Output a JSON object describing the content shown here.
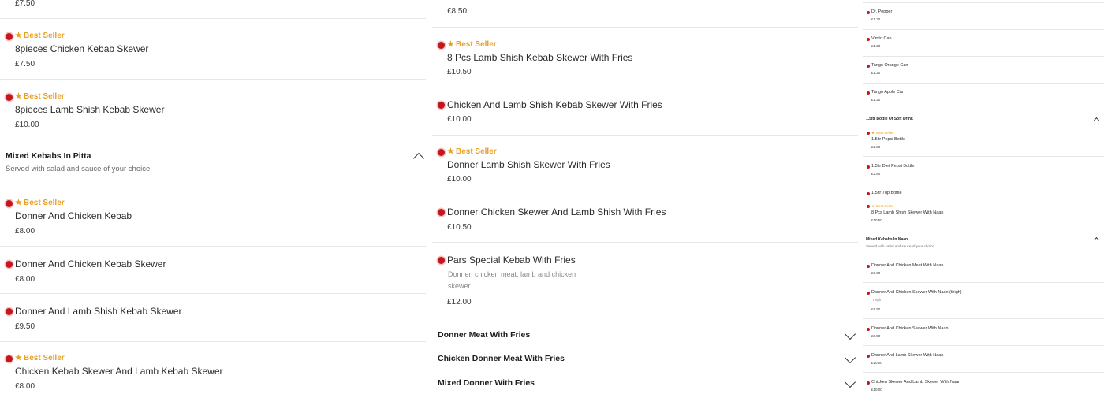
{
  "badge_label": "Best Seller",
  "colors": {
    "accent": "#c4161c",
    "badge": "#e8a024"
  },
  "col1": {
    "top_price": "£7.50",
    "items_a": [
      {
        "name": "8pieces Chicken Kebab Skewer",
        "price": "£7.50",
        "best_seller": true
      },
      {
        "name": "8pieces Lamb Shish Kebab Skewer",
        "price": "£10.00",
        "best_seller": true
      }
    ],
    "section": {
      "title": "Mixed Kebabs In Pitta",
      "subtitle": "Served with salad and sauce of your choice"
    },
    "items_b": [
      {
        "name": "Donner And Chicken Kebab",
        "price": "£8.00",
        "best_seller": true
      },
      {
        "name": "Donner And Chicken Kebab Skewer",
        "price": "£8.00",
        "best_seller": false
      },
      {
        "name": "Donner And Lamb Shish Kebab Skewer",
        "price": "£9.50",
        "best_seller": false
      },
      {
        "name": "Chicken Kebab Skewer And Lamb Kebab Skewer",
        "price": "£8.00",
        "best_seller": true
      }
    ]
  },
  "col2": {
    "top_price": "£8.50",
    "items": [
      {
        "name": "8 Pcs Lamb Shish Kebab Skewer With Fries",
        "price": "£10.50",
        "best_seller": true
      },
      {
        "name": "Chicken And Lamb Shish Kebab Skewer With Fries",
        "price": "£10.00",
        "best_seller": false
      },
      {
        "name": "Donner Lamb Shish Skewer With Fries",
        "price": "£10.00",
        "best_seller": true
      },
      {
        "name": "Donner Chicken Skewer And Lamb Shish With Fries",
        "price": "£10.50",
        "best_seller": false
      },
      {
        "name": "Pars Special Kebab With Fries",
        "desc_line1": "Donner, chicken meat, lamb and chicken",
        "desc_line2": "skewer",
        "price": "£12.00",
        "best_seller": false
      }
    ],
    "sections": [
      {
        "title": "Donner Meat With Fries"
      },
      {
        "title": "Chicken Donner Meat With Fries"
      },
      {
        "title": "Mixed Donner With Fries"
      }
    ]
  },
  "col3": {
    "items_a": [
      {
        "name": "Dr. Pepper",
        "price": "£1.20"
      },
      {
        "name": "Vimto Can",
        "price": "£1.20"
      },
      {
        "name": "Tango Orange Can",
        "price": "£1.20"
      },
      {
        "name": "Tango Apple Can",
        "price": "£1.20"
      }
    ],
    "section1": {
      "title": "1.5ltr Bottle Of Soft Drink"
    },
    "items_b": [
      {
        "name": "1.5ltr Pepsi Bottle",
        "price": "£2.80",
        "best_seller": true
      },
      {
        "name": "1.5ltr Diet Pepsi Bottle",
        "price": "£2.80",
        "best_seller": false
      },
      {
        "name": "1.5ltr 7up Bottle",
        "price": "",
        "best_seller": false
      },
      {
        "name": "8 Pcs Lamb Shish Skewer With Naan",
        "price": "£10.50",
        "best_seller": true
      }
    ],
    "section2": {
      "title": "Mixed Kebabs In Naan",
      "subtitle": "Served with salad and sauce of your choice"
    },
    "items_c": [
      {
        "name": "Donner And Chicken Meat With Naan",
        "price": "£8.00"
      },
      {
        "name": "Donner And Chicken Skewer With Naan (thigh)",
        "desc": "Thigh",
        "price": "£8.50"
      },
      {
        "name": "Donner And Chicken Skewer With Naan",
        "price": "£8.50"
      },
      {
        "name": "Donner And Lamb Skewer With Naan",
        "price": "£10.00"
      },
      {
        "name": "Chicken Skewer And Lamb Skewer With Naan",
        "price": "£10.00"
      }
    ]
  }
}
